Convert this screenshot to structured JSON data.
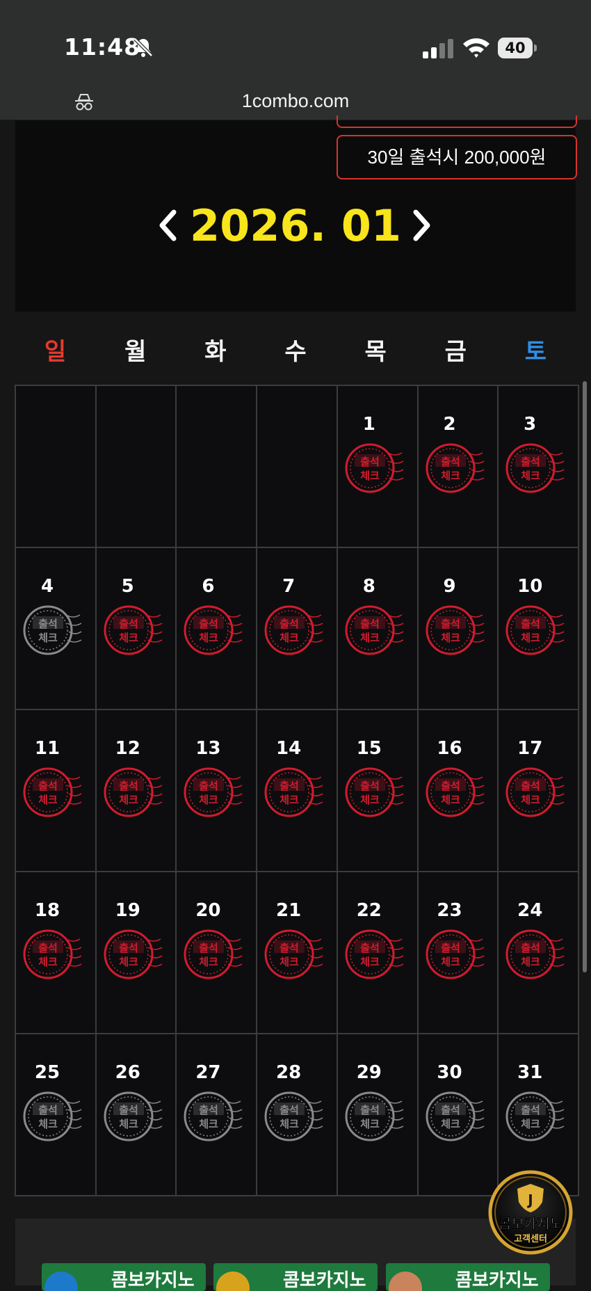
{
  "status": {
    "time": "11:48",
    "battery": "40"
  },
  "browser": {
    "url": "1combo.com"
  },
  "header": {
    "reward_text": "30일 출석시 200,000원",
    "month_label": "2026. 01",
    "prev_icon": "chevron-left-icon",
    "next_icon": "chevron-right-icon"
  },
  "weekdays": [
    "일",
    "월",
    "화",
    "수",
    "목",
    "금",
    "토"
  ],
  "calendar": {
    "leading_blanks": 4,
    "stamp_text_top": "출석",
    "stamp_text_bottom": "체크",
    "checked_color": "#d11c2e",
    "unchecked_color": "#8a8a8a",
    "days": [
      {
        "day": "1",
        "checked": true
      },
      {
        "day": "2",
        "checked": true
      },
      {
        "day": "3",
        "checked": true
      },
      {
        "day": "4",
        "checked": false
      },
      {
        "day": "5",
        "checked": true
      },
      {
        "day": "6",
        "checked": true
      },
      {
        "day": "7",
        "checked": true
      },
      {
        "day": "8",
        "checked": true
      },
      {
        "day": "9",
        "checked": true
      },
      {
        "day": "10",
        "checked": true
      },
      {
        "day": "11",
        "checked": true
      },
      {
        "day": "12",
        "checked": true
      },
      {
        "day": "13",
        "checked": true
      },
      {
        "day": "14",
        "checked": true
      },
      {
        "day": "15",
        "checked": true
      },
      {
        "day": "16",
        "checked": true
      },
      {
        "day": "17",
        "checked": true
      },
      {
        "day": "18",
        "checked": true
      },
      {
        "day": "19",
        "checked": true
      },
      {
        "day": "20",
        "checked": true
      },
      {
        "day": "21",
        "checked": true
      },
      {
        "day": "22",
        "checked": true
      },
      {
        "day": "23",
        "checked": true
      },
      {
        "day": "24",
        "checked": true
      },
      {
        "day": "25",
        "checked": false
      },
      {
        "day": "26",
        "checked": false
      },
      {
        "day": "27",
        "checked": false
      },
      {
        "day": "28",
        "checked": false
      },
      {
        "day": "29",
        "checked": false
      },
      {
        "day": "30",
        "checked": false
      },
      {
        "day": "31",
        "checked": false
      }
    ]
  },
  "support": {
    "title": "콤보카지노",
    "subtitle": "고객센터"
  },
  "banners": [
    "콤보카지노",
    "콤보카지노",
    "콤보카지노"
  ]
}
